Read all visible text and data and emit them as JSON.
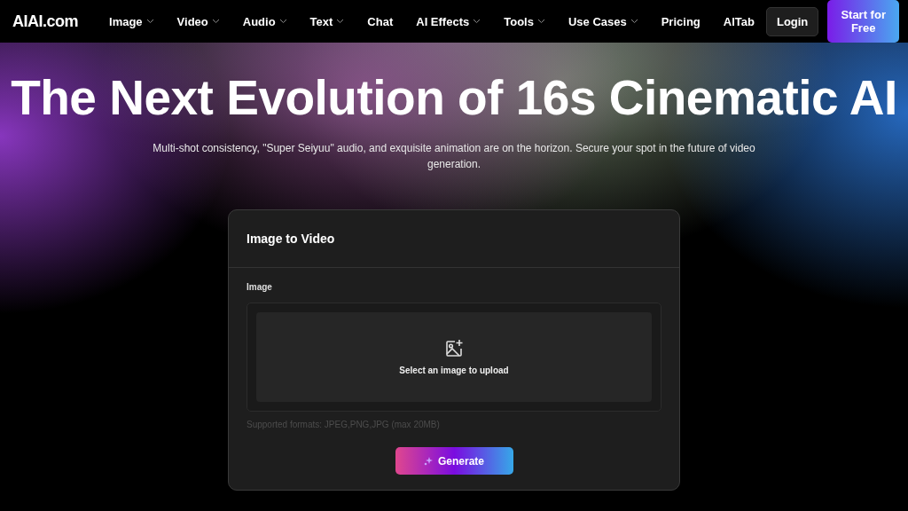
{
  "logo": "AIAI.com",
  "nav": [
    {
      "label": "Image",
      "has_menu": true
    },
    {
      "label": "Video",
      "has_menu": true
    },
    {
      "label": "Audio",
      "has_menu": true
    },
    {
      "label": "Text",
      "has_menu": true
    },
    {
      "label": "Chat",
      "has_menu": false
    },
    {
      "label": "AI Effects",
      "has_menu": true
    },
    {
      "label": "Tools",
      "has_menu": true
    },
    {
      "label": "Use Cases",
      "has_menu": true
    },
    {
      "label": "Pricing",
      "has_menu": false
    },
    {
      "label": "AITab",
      "has_menu": false
    }
  ],
  "login": "Login",
  "signup": "Start for Free",
  "hero": {
    "title": "The Next Evolution of 16s Cinematic AI",
    "subtitle": "Multi-shot consistency, \"Super Seiyuu\" audio, and exquisite animation are on the horizon. Secure your spot in the future of video generation."
  },
  "card": {
    "title": "Image to Video",
    "field_label": "Image",
    "upload_text": "Select an image to upload",
    "formats": "Supported formats: JPEG,PNG,JPG (max 20MB)",
    "button": "Generate"
  }
}
